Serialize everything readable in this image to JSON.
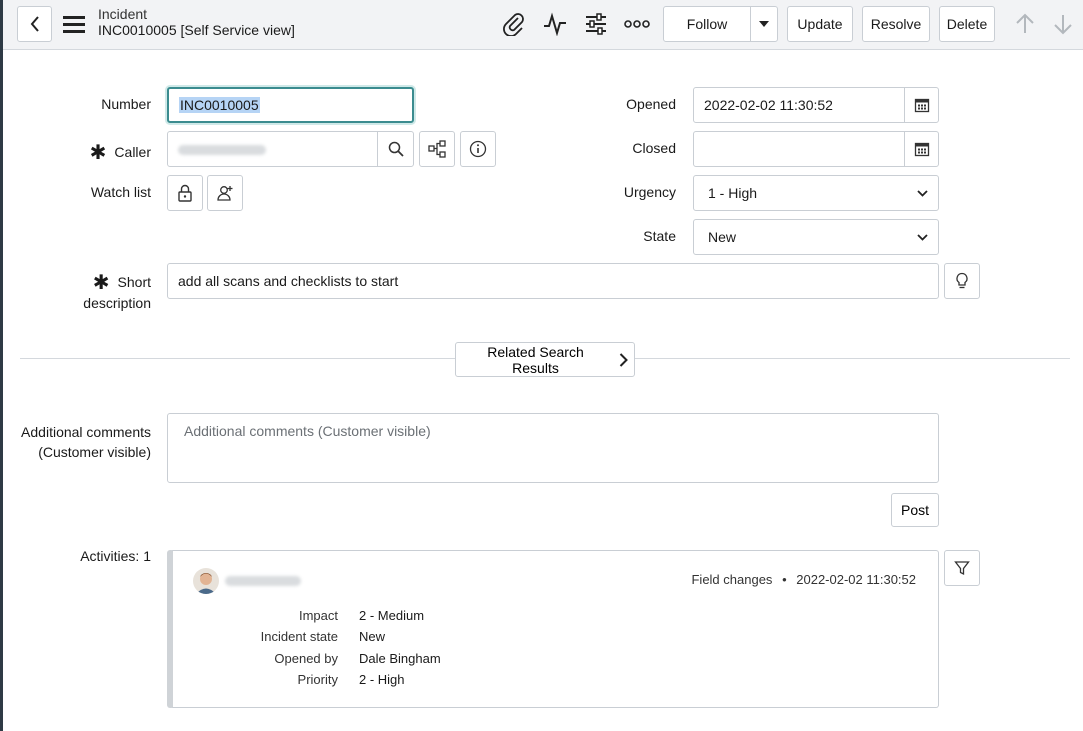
{
  "header": {
    "title_line1": "Incident",
    "title_line2": "INC0010005 [Self Service view]",
    "follow_label": "Follow",
    "update_label": "Update",
    "resolve_label": "Resolve",
    "delete_label": "Delete"
  },
  "form": {
    "number_label": "Number",
    "number_value": "INC0010005",
    "caller_label": "Caller",
    "watch_list_label": "Watch list",
    "opened_label": "Opened",
    "opened_value": "2022-02-02 11:30:52",
    "closed_label": "Closed",
    "closed_value": "",
    "urgency_label": "Urgency",
    "urgency_value": "1 - High",
    "state_label": "State",
    "state_value": "New",
    "short_desc_label_1": "Short",
    "short_desc_label_2": "description",
    "short_desc_value": "add all scans and checklists to start",
    "related_search_label": "Related Search Results",
    "comments_label_1": "Additional comments",
    "comments_label_2": "(Customer visible)",
    "comments_placeholder": "Additional comments (Customer visible)",
    "post_label": "Post",
    "activities_label": "Activities: 1"
  },
  "activity": {
    "meta_type": "Field changes",
    "meta_sep": "•",
    "meta_time": "2022-02-02 11:30:52",
    "rows": [
      {
        "key": "Impact",
        "value": "2 - Medium"
      },
      {
        "key": "Incident state",
        "value": "New"
      },
      {
        "key": "Opened by",
        "value": "Dale Bingham"
      },
      {
        "key": "Priority",
        "value": "2 - High"
      }
    ]
  },
  "icons": {
    "back": "chevron-left-icon",
    "menu": "hamburger-icon",
    "attach": "paperclip-icon",
    "activity": "pulse-icon",
    "settings": "sliders-icon",
    "more": "more-icon",
    "up": "arrow-up-icon",
    "down": "arrow-down-icon"
  },
  "colors": {
    "focus_border": "#3b8c8f",
    "selection": "#b6d4f5",
    "header_bg": "#f2f3f5"
  }
}
